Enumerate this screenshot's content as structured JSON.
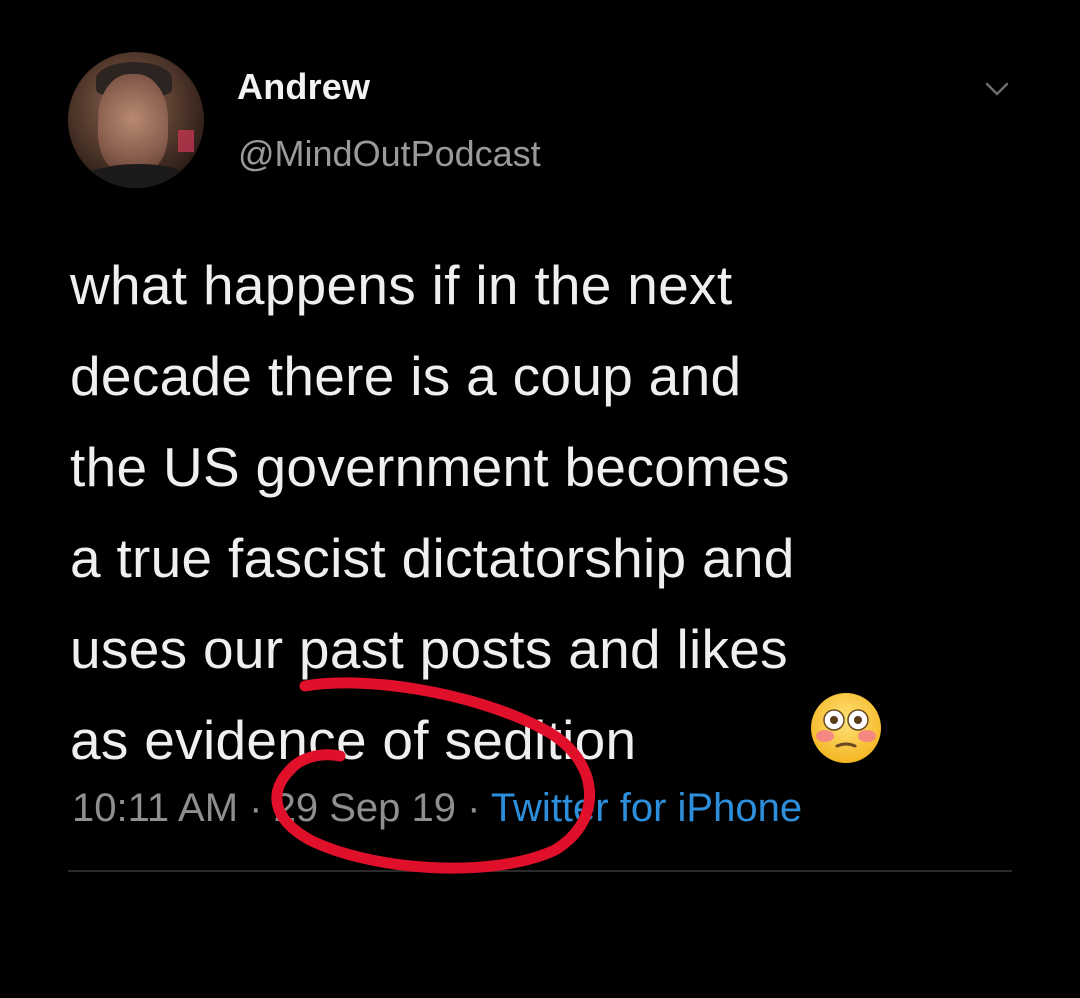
{
  "tweet": {
    "display_name": "Andrew",
    "handle": "@MindOutPodcast",
    "text": "what happens if in the next\ndecade there is a coup and\nthe US government becomes\na true fascist dictatorship and\nuses our past posts and likes\nas evidence of sedition",
    "emoji_icon": "flushed-face-emoji",
    "time": "10:11 AM",
    "separator": " · ",
    "date": "29 Sep 19",
    "source": "Twitter for iPhone"
  },
  "colors": {
    "background": "#000000",
    "text": "#efefef",
    "secondary_text": "#8f8f8f",
    "link": "#2d8fdc",
    "annotation_stroke": "#e0102a"
  },
  "icons": {
    "menu": "chevron-down-icon",
    "avatar": "profile-photo"
  }
}
